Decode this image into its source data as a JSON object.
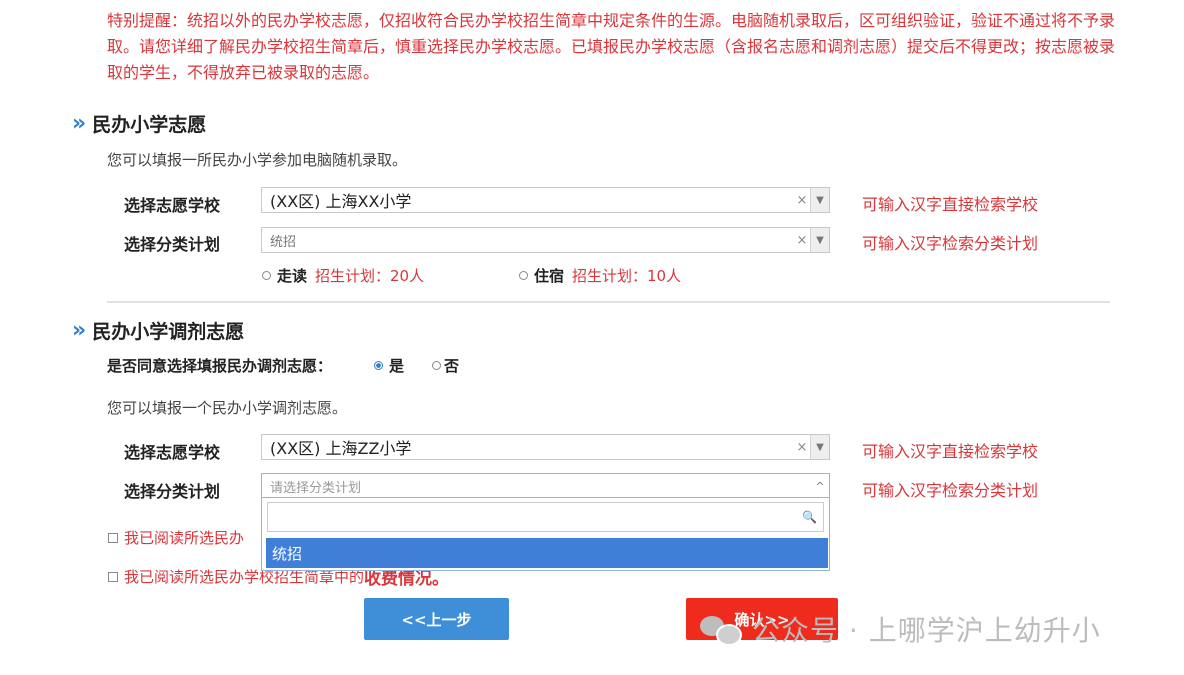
{
  "notice": "特别提醒：统招以外的民办学校志愿，仅招收符合民办学校招生简章中规定条件的生源。电脑随机录取后，区可组织验证，验证不通过将不予录取。请您详细了解民办学校招生简章后，慎重选择民办学校志愿。已填报民办学校志愿（含报名志愿和调剂志愿）提交后不得更改；按志愿被录取的学生，不得放弃已被录取的志愿。",
  "section1": {
    "title": "民办小学志愿",
    "hint": "您可以填报一所民办小学参加电脑随机录取。",
    "school": {
      "label": "选择志愿学校",
      "value": "(XX区) 上海XX小学",
      "side_hint": "可输入汉字直接检索学校"
    },
    "plan": {
      "label": "选择分类计划",
      "value": "统招",
      "side_hint": "可输入汉字检索分类计划"
    },
    "options": [
      {
        "label": "走读",
        "quota": "招生计划：20人"
      },
      {
        "label": "住宿",
        "quota": "招生计划：10人"
      }
    ]
  },
  "section2": {
    "title": "民办小学调剂志愿",
    "agree_label": "是否同意选择填报民办调剂志愿：",
    "agree_yes": "是",
    "agree_no": "否",
    "hint": "您可以填报一个民办小学调剂志愿。",
    "school": {
      "label": "选择志愿学校",
      "value": "(XX区) 上海ZZ小学",
      "side_hint": "可输入汉字直接检索学校"
    },
    "plan": {
      "label": "选择分类计划",
      "placeholder": "请选择分类计划",
      "side_hint": "可输入汉字检索分类计划",
      "dropdown_option": "统招"
    }
  },
  "consent": {
    "line1": "我已阅读所选民办",
    "line2_prefix": "我已阅读所选民办学校招生简章中的",
    "line2_strong": "收费情况。"
  },
  "buttons": {
    "prev": "<<上一步",
    "confirm": "确认>>"
  },
  "watermark": "公众号 · 上哪学沪上幼升小",
  "icons": {
    "chevrons": "»",
    "clear": "×",
    "arrow_down": "▼",
    "arrow_up": "^",
    "search": "🔍"
  }
}
